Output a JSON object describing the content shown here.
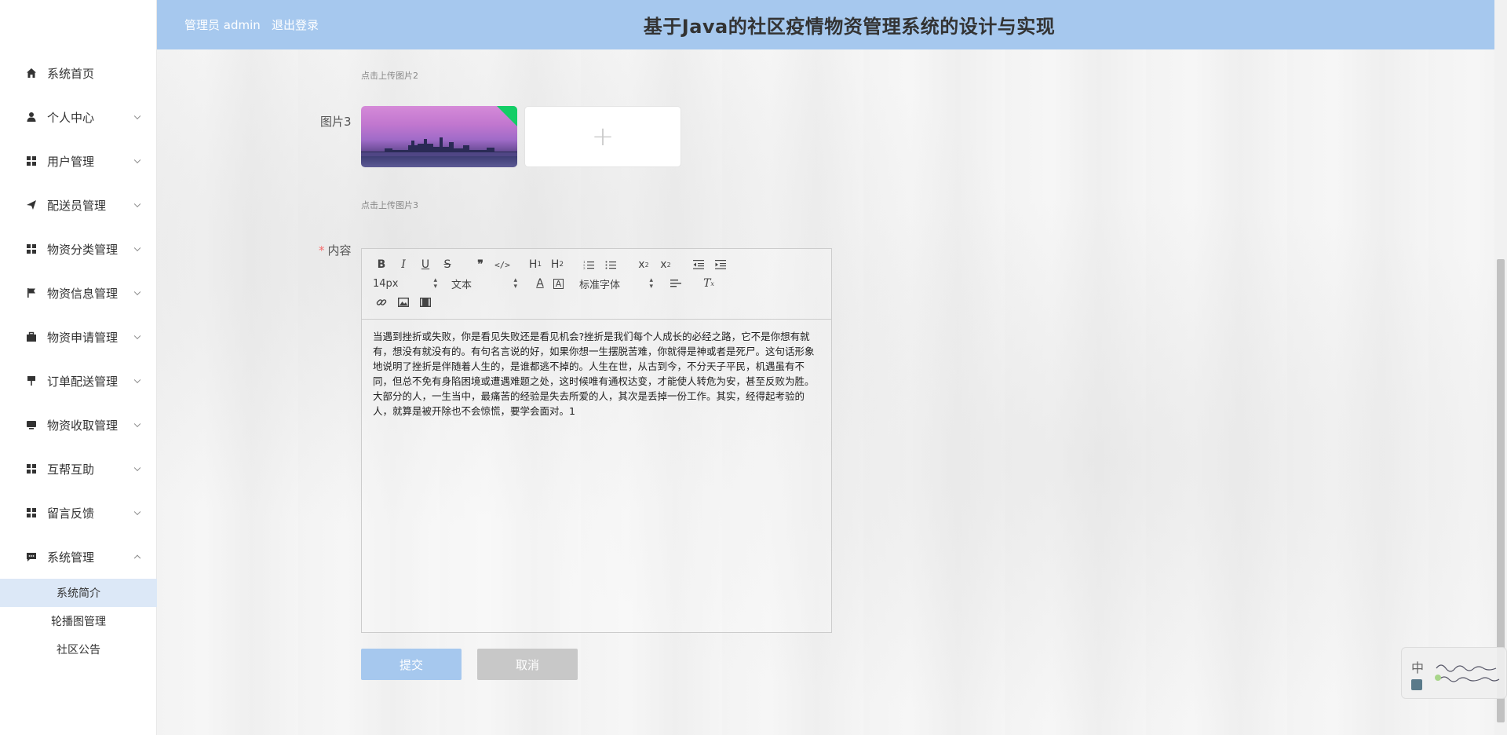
{
  "header": {
    "admin_text": "管理员 admin",
    "logout_label": "退出登录",
    "title": "基于Java的社区疫情物资管理系统的设计与实现"
  },
  "sidebar": {
    "items": [
      {
        "label": "系统首页",
        "icon": "home-icon"
      },
      {
        "label": "个人中心",
        "icon": "user-icon"
      },
      {
        "label": "用户管理",
        "icon": "grid-icon"
      },
      {
        "label": "配送员管理",
        "icon": "send-icon"
      },
      {
        "label": "物资分类管理",
        "icon": "grid-icon"
      },
      {
        "label": "物资信息管理",
        "icon": "flag-icon"
      },
      {
        "label": "物资申请管理",
        "icon": "briefcase-icon"
      },
      {
        "label": "订单配送管理",
        "icon": "pin-icon"
      },
      {
        "label": "物资收取管理",
        "icon": "monitor-icon"
      },
      {
        "label": "互帮互助",
        "icon": "grid-icon"
      },
      {
        "label": "留言反馈",
        "icon": "grid-icon"
      },
      {
        "label": "系统管理",
        "icon": "chat-icon"
      }
    ],
    "submenu": [
      "系统简介",
      "轮播图管理",
      "社区公告"
    ]
  },
  "form": {
    "hint2": "点击上传图片2",
    "label_img3": "图片3",
    "hint3": "点击上传图片3",
    "required_mark": "*",
    "label_content": "内容"
  },
  "editor": {
    "font_size": "14px",
    "text_type": "文本",
    "font_family": "标准字体",
    "content": "当遇到挫折或失败，你是看见失败还是看见机会?挫折是我们每个人成长的必经之路，它不是你想有就有，想没有就没有的。有句名言说的好，如果你想一生摆脱苦难，你就得是神或者是死尸。这句话形象地说明了挫折是伴随着人生的，是谁都逃不掉的。人生在世，从古到今，不分天子平民，机遇虽有不同，但总不免有身陷困境或遭遇难题之处，这时候唯有通权达变，才能使人转危为安，甚至反败为胜。大部分的人，一生当中，最痛苦的经验是失去所爱的人，其次是丢掉一份工作。其实，经得起考验的人，就算是被开除也不会惊慌，要学会面对。1"
  },
  "buttons": {
    "submit": "提交",
    "cancel": "取消"
  },
  "ime": {
    "label": "中"
  },
  "colors": {
    "header_bg": "#a6c8ee",
    "active_submenu_bg": "#dce8f7",
    "required": "#f56c6c",
    "cancel_bg": "#c8c8c8"
  }
}
